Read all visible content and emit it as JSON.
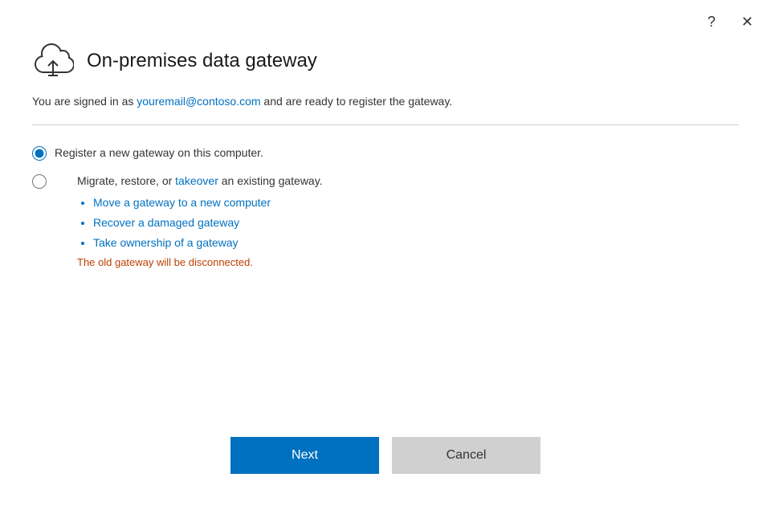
{
  "dialog": {
    "title": "On-premises data gateway",
    "subtitle_prefix": "You are signed in as ",
    "email": "youremail@contoso.com",
    "subtitle_suffix": " and are ready to register the gateway.",
    "option1_label": "Register a new gateway on this computer.",
    "option2_label": "Migrate, restore, or ",
    "option2_link": "takeover",
    "option2_suffix": " an existing gateway.",
    "bullet1": "Move a gateway to a new computer",
    "bullet2": "Recover a damaged gateway",
    "bullet3": "Take ownership of a gateway",
    "disclaimer": "The old gateway will be disconnected.",
    "next_label": "Next",
    "cancel_label": "Cancel",
    "help_icon": "?",
    "close_icon": "✕"
  }
}
